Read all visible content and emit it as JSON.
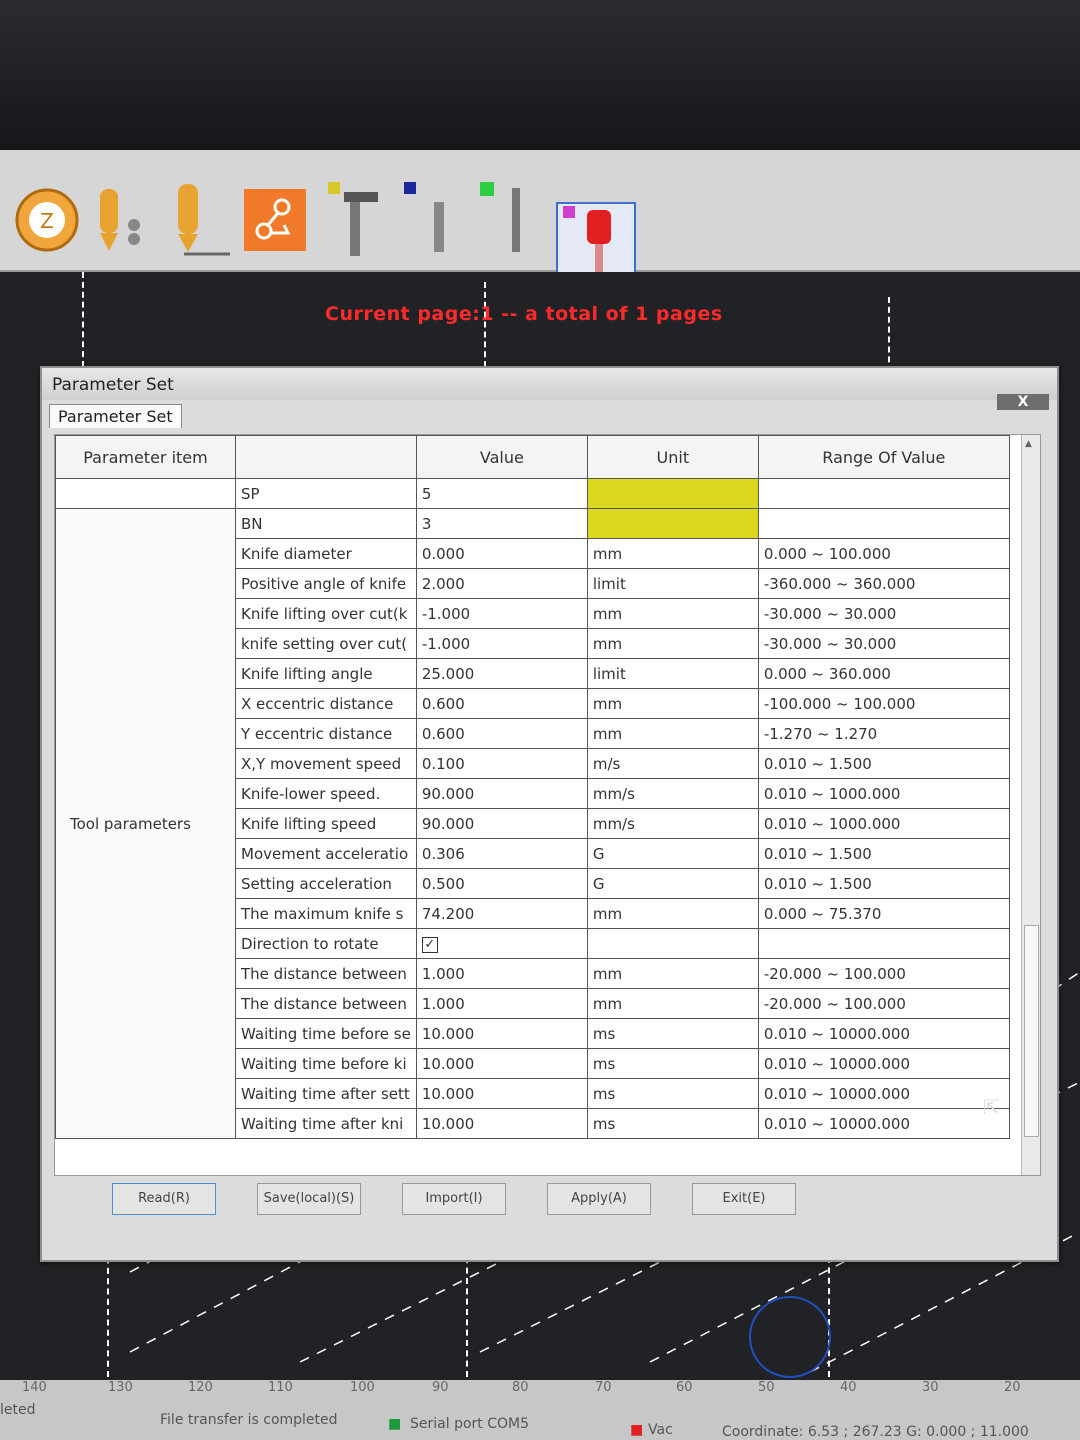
{
  "toolbar": {
    "icons": [
      "z-origin-icon",
      "pen-tool-icon",
      "knife-tool-icon",
      "route-icon",
      "hammer-tool-icon",
      "pen-small-icon",
      "blade-icon",
      "red-knife-icon"
    ]
  },
  "page_info": "Current page:1 -- a total of 1 pages",
  "dialog": {
    "title": "Parameter Set",
    "close": "X",
    "tab": "Parameter Set",
    "columns": {
      "item": "Parameter item",
      "value": "Value",
      "unit": "Unit",
      "range": "Range Of Value"
    },
    "group_label": "Tool parameters",
    "rows": [
      {
        "name": "SP",
        "value": "5",
        "unit": "",
        "range": ""
      },
      {
        "name": "BN",
        "value": "3",
        "unit": "",
        "range": ""
      },
      {
        "name": "Knife diameter",
        "value": "0.000",
        "unit": "mm",
        "range": "0.000 ~ 100.000"
      },
      {
        "name": "Positive angle of knife",
        "value": "2.000",
        "unit": "limit",
        "range": "-360.000 ~ 360.000"
      },
      {
        "name": "Knife lifting over cut(k",
        "value": "-1.000",
        "unit": "mm",
        "range": "-30.000 ~ 30.000"
      },
      {
        "name": "knife setting over cut(",
        "value": "-1.000",
        "unit": "mm",
        "range": "-30.000 ~ 30.000"
      },
      {
        "name": "Knife lifting angle",
        "value": "25.000",
        "unit": "limit",
        "range": "0.000 ~ 360.000"
      },
      {
        "name": "X eccentric distance",
        "value": "0.600",
        "unit": "mm",
        "range": "-100.000 ~ 100.000"
      },
      {
        "name": "Y eccentric distance",
        "value": "0.600",
        "unit": "mm",
        "range": "-1.270 ~ 1.270"
      },
      {
        "name": "X,Y movement speed",
        "value": "0.100",
        "unit": "m/s",
        "range": "0.010 ~ 1.500"
      },
      {
        "name": "Knife-lower speed.",
        "value": "90.000",
        "unit": "mm/s",
        "range": "0.010 ~ 1000.000"
      },
      {
        "name": "Knife lifting speed",
        "value": "90.000",
        "unit": "mm/s",
        "range": "0.010 ~ 1000.000"
      },
      {
        "name": "Movement acceleratio",
        "value": "0.306",
        "unit": "G",
        "range": "0.010 ~ 1.500"
      },
      {
        "name": "Setting acceleration",
        "value": "0.500",
        "unit": "G",
        "range": "0.010 ~ 1.500"
      },
      {
        "name": "The maximum knife s",
        "value": "74.200",
        "unit": "mm",
        "range": "0.000 ~ 75.370"
      },
      {
        "name": "Direction to rotate",
        "value": "✓",
        "unit": "",
        "range": ""
      },
      {
        "name": "The distance between",
        "value": "1.000",
        "unit": "mm",
        "range": "-20.000 ~ 100.000"
      },
      {
        "name": "The distance between",
        "value": "1.000",
        "unit": "mm",
        "range": "-20.000 ~ 100.000"
      },
      {
        "name": "Waiting time before se",
        "value": "10.000",
        "unit": "ms",
        "range": "0.010 ~ 10000.000"
      },
      {
        "name": "Waiting time before ki",
        "value": "10.000",
        "unit": "ms",
        "range": "0.010 ~ 10000.000"
      },
      {
        "name": "Waiting time after sett",
        "value": "10.000",
        "unit": "ms",
        "range": "0.010 ~ 10000.000"
      },
      {
        "name": "Waiting time after kni",
        "value": "10.000",
        "unit": "ms",
        "range": "0.010 ~ 10000.000"
      }
    ],
    "buttons": {
      "read": "Read(R)",
      "save": "Save(local)(S)",
      "import": "Import(I)",
      "apply": "Apply(A)",
      "exit": "Exit(E)"
    }
  },
  "ruler": [
    "140",
    "130",
    "120",
    "110",
    "100",
    "90",
    "80",
    "70",
    "60",
    "50",
    "40",
    "30",
    "20"
  ],
  "status": {
    "left": "leted",
    "transfer": "File transfer is completed",
    "serial": "Serial port COM5",
    "vac": "Vac",
    "coordinate": "Coordinate: 6.53 ; 267.23 G: 0.000 ; 11.000"
  },
  "colors": {
    "highlight": "#dcd820",
    "page_info": "#ff2a2a",
    "selected_tool": "#3a6fd0"
  }
}
